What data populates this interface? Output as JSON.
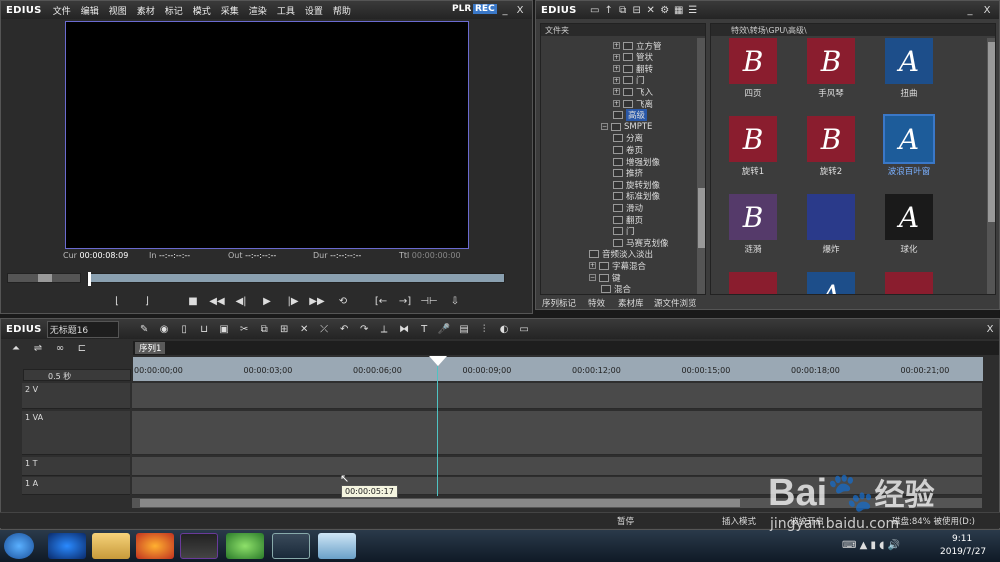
{
  "player": {
    "logo": "EDIUS",
    "menu": [
      "文件",
      "编辑",
      "视图",
      "素材",
      "标记",
      "模式",
      "采集",
      "渲染",
      "工具",
      "设置",
      "帮助"
    ],
    "plr_label": "PLR",
    "rec_label": "REC",
    "minimize": "_",
    "maximize": "□",
    "close": "X",
    "timecodes": [
      {
        "label": "Cur",
        "value": "00:00:08:09"
      },
      {
        "label": "In",
        "value": "--:--:--:--"
      },
      {
        "label": "Out",
        "value": "--:--:--:--"
      },
      {
        "label": "Dur",
        "value": "--:--:--:--"
      },
      {
        "label": "Ttl",
        "value": "00:00:00:00"
      }
    ]
  },
  "effects": {
    "logo": "EDIUS",
    "folder_header": "文件夹",
    "path": "特效\\转场\\GPU\\高级\\",
    "tree": [
      {
        "label": "立方管",
        "indent": 1,
        "type": "plus"
      },
      {
        "label": "管状",
        "indent": 1,
        "type": "plus"
      },
      {
        "label": "翻转",
        "indent": 1,
        "type": "plus"
      },
      {
        "label": "门",
        "indent": 1,
        "type": "plus"
      },
      {
        "label": "飞入",
        "indent": 1,
        "type": "plus"
      },
      {
        "label": "飞离",
        "indent": 1,
        "type": "plus"
      },
      {
        "label": "高级",
        "indent": 1,
        "type": "selected"
      },
      {
        "label": "SMPTE",
        "indent": 0,
        "type": "minus"
      },
      {
        "label": "分离",
        "indent": 1,
        "type": "leaf"
      },
      {
        "label": "卷页",
        "indent": 1,
        "type": "leaf"
      },
      {
        "label": "增强划像",
        "indent": 1,
        "type": "leaf"
      },
      {
        "label": "推挤",
        "indent": 1,
        "type": "leaf"
      },
      {
        "label": "旋转划像",
        "indent": 1,
        "type": "leaf"
      },
      {
        "label": "标准划像",
        "indent": 1,
        "type": "leaf"
      },
      {
        "label": "滑动",
        "indent": 1,
        "type": "leaf"
      },
      {
        "label": "翻页",
        "indent": 1,
        "type": "leaf"
      },
      {
        "label": "门",
        "indent": 1,
        "type": "leaf"
      },
      {
        "label": "马赛克划像",
        "indent": 1,
        "type": "leaf"
      },
      {
        "label": "音频淡入淡出",
        "indent": -1,
        "type": "leaf"
      },
      {
        "label": "字幕混合",
        "indent": -1,
        "type": "plus"
      },
      {
        "label": "键",
        "indent": -1,
        "type": "minus"
      },
      {
        "label": "混合",
        "indent": 0,
        "type": "leaf"
      }
    ],
    "thumbnails": [
      {
        "label": "四页",
        "glyph": "B",
        "bg": "#8a1d2e"
      },
      {
        "label": "手风琴",
        "glyph": "B",
        "bg": "#8a1d2e"
      },
      {
        "label": "扭曲",
        "glyph": "A",
        "bg": "#1d4e8a"
      },
      {
        "label": "旋转1",
        "glyph": "B",
        "bg": "#8a1d2e"
      },
      {
        "label": "旋转2",
        "glyph": "B",
        "bg": "#8a1d2e"
      },
      {
        "label": "波浪百叶窗",
        "glyph": "A",
        "bg": "#1d5c9a"
      },
      {
        "label": "涟漪",
        "glyph": "B",
        "bg": "#553a6a"
      },
      {
        "label": "爆炸",
        "glyph": "",
        "bg": "#2a3a8a"
      },
      {
        "label": "球化",
        "glyph": "A",
        "bg": "#1a1a1a"
      },
      {
        "label": "",
        "glyph": "",
        "bg": "#8a1d2e"
      },
      {
        "label": "",
        "glyph": "A",
        "bg": "#1d4e8a"
      },
      {
        "label": "",
        "glyph": "",
        "bg": "#8a1d2e"
      }
    ],
    "tabs": [
      "序列标记",
      "特效",
      "素材库",
      "源文件浏览"
    ]
  },
  "timeline": {
    "logo": "EDIUS",
    "project_name": "无标题16",
    "sequence_tab": "序列1",
    "zoom": "0.5 秒",
    "ruler": [
      "00:00:00;00",
      "00:00:03;00",
      "00:00:06;00",
      "00:00:09;00",
      "00:00:12;00",
      "00:00:15;00",
      "00:00:18;00",
      "00:00:21;00"
    ],
    "tracks": [
      {
        "name": "2 V"
      },
      {
        "name": "1 VA"
      },
      {
        "name": "1 T"
      },
      {
        "name": "1 A"
      }
    ],
    "tooltip": "00:00:05:17",
    "status": {
      "pause": "暂停",
      "insert_mode": "插入模式",
      "ripple": "波纹开启",
      "disk": "磁盘:84% 被使用(D:)"
    }
  },
  "taskbar": {
    "time": "9:11",
    "date": "2019/7/27"
  },
  "watermark": {
    "brand": "Bai",
    "suffix": "经验",
    "url": "jingyan.baidu.com"
  },
  "colors": {
    "accent": "#3a78c8",
    "selected": "#2a58a8",
    "playhead": "#4fc3c3"
  }
}
